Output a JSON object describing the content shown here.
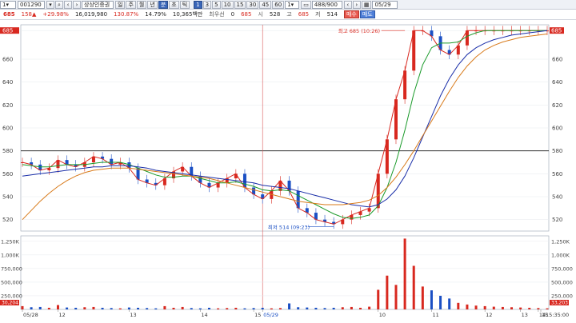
{
  "toolbar": {
    "period_value": "1",
    "code_value": "001290",
    "stock_name": "상상인증권",
    "period_tabs": [
      "일",
      "주",
      "월",
      "년",
      "분",
      "초",
      "틱"
    ],
    "interval_buttons": [
      "1",
      "3",
      "5",
      "10",
      "15",
      "30",
      "45",
      "60"
    ],
    "interval_value": "1",
    "count_value": "488/900",
    "date_value": "05/29"
  },
  "quote": {
    "price": "685",
    "change": "158",
    "change_pct": "+29.98%",
    "volume": "16,019,980",
    "vol_ratio": "130.87%",
    "turnover": "14.79%",
    "amount": "10,365백만",
    "pref_label": "최우선",
    "pref_value": "0",
    "open_label": "시",
    "open_value": "528",
    "high_label": "고",
    "high_value": "685",
    "low_label": "저",
    "low_value": "514",
    "buy_label": "매수",
    "sell_label": "매도"
  },
  "colors": {
    "up": "#d8281f",
    "down": "#1a4fc4",
    "ma5": "#d8281f",
    "ma20": "#1a9a2a",
    "ma60": "#1a2ea8",
    "ma120": "#d87a1a"
  },
  "chart_data": [
    {
      "type": "line",
      "panel": "price",
      "y_ticks": [
        520,
        540,
        560,
        580,
        600,
        620,
        640,
        660,
        685
      ],
      "ylim": [
        510,
        690
      ],
      "reference_line": 580,
      "current_price_label": "685",
      "annotations": {
        "high": "최고 685 (10:26)",
        "low": "최저 514 (09:23)"
      },
      "x_labels": [
        "05/28",
        "12",
        "13",
        "14",
        "15",
        "05/29",
        "10",
        "11",
        "12",
        "13",
        "14",
        "15"
      ],
      "time_label": "15:35:00",
      "series": [
        {
          "values": [
            570,
            568,
            563,
            565,
            572,
            568,
            566,
            570,
            575,
            573,
            568,
            570,
            565,
            555,
            552,
            550,
            556,
            562,
            566,
            558,
            552,
            548,
            552,
            556,
            560,
            548,
            542,
            538,
            545,
            554,
            545,
            530,
            526,
            520,
            518,
            516,
            520,
            524,
            527,
            530,
            560,
            590,
            625,
            650,
            685,
            685,
            680,
            668,
            664,
            672,
            685,
            685,
            685,
            685,
            685,
            685,
            685,
            685,
            685,
            685
          ]
        },
        {
          "values": [
            568,
            567,
            566,
            566,
            567,
            568,
            568,
            568,
            569,
            570,
            570,
            570,
            568,
            565,
            562,
            559,
            557,
            557,
            558,
            558,
            556,
            554,
            552,
            552,
            553,
            551,
            549,
            546,
            545,
            546,
            545,
            541,
            537,
            533,
            529,
            525,
            522,
            521,
            522,
            524,
            532,
            548,
            570,
            598,
            630,
            655,
            670,
            674,
            674,
            675,
            680,
            683,
            685,
            685,
            685,
            685,
            685,
            685,
            685,
            685
          ]
        },
        {
          "values": [
            558,
            559,
            560,
            561,
            562,
            563,
            564,
            565,
            566,
            566,
            567,
            567,
            567,
            566,
            565,
            563,
            562,
            561,
            560,
            559,
            558,
            557,
            556,
            555,
            554,
            553,
            552,
            550,
            549,
            548,
            547,
            545,
            543,
            541,
            539,
            537,
            535,
            533,
            532,
            531,
            533,
            538,
            546,
            558,
            574,
            592,
            610,
            628,
            643,
            655,
            664,
            670,
            674,
            677,
            679,
            681,
            682,
            683,
            684,
            685
          ]
        },
        {
          "values": [
            520,
            528,
            536,
            543,
            549,
            554,
            558,
            561,
            563,
            564,
            565,
            565,
            565,
            564,
            563,
            562,
            561,
            560,
            559,
            558,
            557,
            556,
            554,
            552,
            550,
            548,
            546,
            544,
            542,
            540,
            538,
            536,
            535,
            534,
            533,
            533,
            533,
            534,
            535,
            537,
            541,
            548,
            557,
            568,
            580,
            593,
            606,
            619,
            632,
            644,
            654,
            662,
            668,
            672,
            675,
            677,
            679,
            680,
            681,
            682
          ]
        }
      ]
    },
    {
      "type": "bar",
      "panel": "volume",
      "y_ticks": [
        "1,250K",
        "1,000K",
        "750,000",
        "500,000",
        "250,000"
      ],
      "ylim": [
        0,
        1350000
      ],
      "ma_labels": [
        "30,204",
        "33,203"
      ],
      "values": [
        60000,
        40000,
        45000,
        30000,
        80000,
        35000,
        30000,
        40000,
        45000,
        30000,
        25000,
        20000,
        35000,
        30000,
        25000,
        20000,
        60000,
        30000,
        45000,
        25000,
        20000,
        30000,
        20000,
        25000,
        30000,
        20000,
        25000,
        30000,
        20000,
        25000,
        110000,
        40000,
        35000,
        30000,
        25000,
        30000,
        40000,
        45000,
        30000,
        50000,
        360000,
        620000,
        450000,
        1300000,
        800000,
        420000,
        350000,
        250000,
        200000,
        120000,
        90000,
        70000,
        60000,
        50000,
        45000,
        40000,
        35000,
        30000,
        25000,
        20000
      ]
    }
  ]
}
